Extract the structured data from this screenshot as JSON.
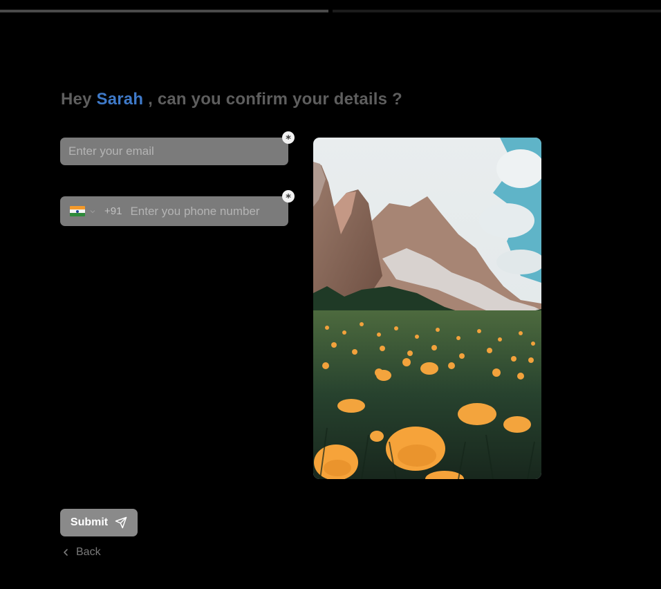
{
  "progress": {
    "steps": 2,
    "completed": 1
  },
  "heading": {
    "greeting": "Hey",
    "name": "Sarah",
    "question": ", can you confirm your details ?"
  },
  "email": {
    "placeholder": "Enter your email",
    "value": ""
  },
  "phone": {
    "country_flag": "india-flag-icon",
    "dial_code": "+91",
    "placeholder": "Enter you phone number",
    "value": ""
  },
  "required_marker": "*",
  "actions": {
    "submit_label": "Submit",
    "back_label": "Back"
  },
  "colors": {
    "background": "#000000",
    "accent_name": "#3f7ac9",
    "heading_text": "#5e5e5e",
    "field_bg": "#7b7b7b",
    "button_bg": "#8a8a8a"
  },
  "icons": {
    "submit": "send-icon",
    "back": "chevron-left-icon",
    "country_dropdown": "chevron-down-icon"
  }
}
